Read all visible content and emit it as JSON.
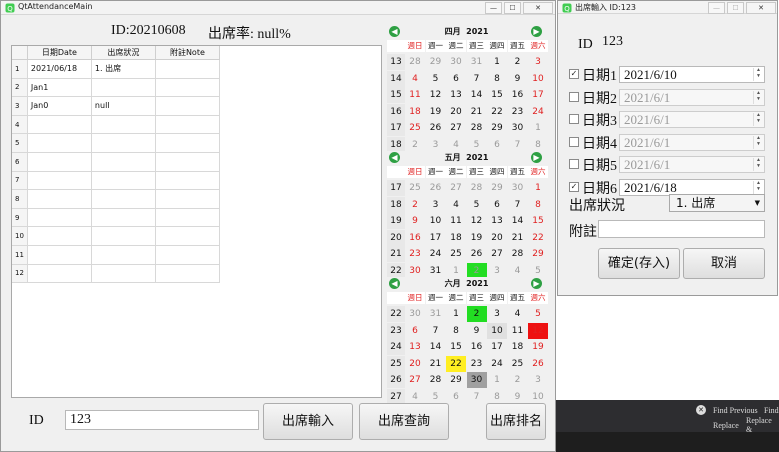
{
  "main": {
    "title": "QtAttendanceMain",
    "header_id": "ID:20210608",
    "header_rate": "出席率: null%",
    "table": {
      "columns": [
        "日期Date",
        "出席狀況",
        "附註Note"
      ],
      "rows": [
        {
          "num": "1",
          "date": "2021/06/18",
          "status": "1. 出席",
          "note": ""
        },
        {
          "num": "2",
          "date": "Jan1",
          "status": "",
          "note": ""
        },
        {
          "num": "3",
          "date": "Jan0",
          "status": "null",
          "note": ""
        },
        {
          "num": "4",
          "date": "",
          "status": "",
          "note": ""
        },
        {
          "num": "5",
          "date": "",
          "status": "",
          "note": ""
        },
        {
          "num": "6",
          "date": "",
          "status": "",
          "note": ""
        },
        {
          "num": "7",
          "date": "",
          "status": "",
          "note": ""
        },
        {
          "num": "8",
          "date": "",
          "status": "",
          "note": ""
        },
        {
          "num": "9",
          "date": "",
          "status": "",
          "note": ""
        },
        {
          "num": "10",
          "date": "",
          "status": "",
          "note": ""
        },
        {
          "num": "11",
          "date": "",
          "status": "",
          "note": ""
        },
        {
          "num": "12",
          "date": "",
          "status": "",
          "note": ""
        }
      ]
    },
    "id_label": "ID",
    "id_value": "123",
    "buttons": {
      "input": "出席輸入",
      "query": "出席查詢",
      "rank": "出席排名"
    }
  },
  "calendars": [
    {
      "month": "四月",
      "year": "2021",
      "dow": [
        "週日",
        "週一",
        "週二",
        "週三",
        "週四",
        "週五",
        "週六"
      ],
      "weeks": [
        {
          "wk": "13",
          "days": [
            "28",
            "29",
            "30",
            "31",
            "1",
            "2",
            "3"
          ]
        },
        {
          "wk": "14",
          "days": [
            "4",
            "5",
            "6",
            "7",
            "8",
            "9",
            "10"
          ]
        },
        {
          "wk": "15",
          "days": [
            "11",
            "12",
            "13",
            "14",
            "15",
            "16",
            "17"
          ]
        },
        {
          "wk": "16",
          "days": [
            "18",
            "19",
            "20",
            "21",
            "22",
            "23",
            "24"
          ]
        },
        {
          "wk": "17",
          "days": [
            "25",
            "26",
            "27",
            "28",
            "29",
            "30",
            "1"
          ]
        },
        {
          "wk": "18",
          "days": [
            "2",
            "3",
            "4",
            "5",
            "6",
            "7",
            "8"
          ]
        }
      ],
      "grey": [
        [
          0,
          0
        ],
        [
          0,
          1
        ],
        [
          0,
          2
        ],
        [
          0,
          3
        ],
        [
          4,
          6
        ],
        [
          5,
          0
        ],
        [
          5,
          1
        ],
        [
          5,
          2
        ],
        [
          5,
          3
        ],
        [
          5,
          4
        ],
        [
          5,
          5
        ],
        [
          5,
          6
        ]
      ],
      "highlights": []
    },
    {
      "month": "五月",
      "year": "2021",
      "dow": [
        "週日",
        "週一",
        "週二",
        "週三",
        "週四",
        "週五",
        "週六"
      ],
      "weeks": [
        {
          "wk": "17",
          "days": [
            "25",
            "26",
            "27",
            "28",
            "29",
            "30",
            "1"
          ]
        },
        {
          "wk": "18",
          "days": [
            "2",
            "3",
            "4",
            "5",
            "6",
            "7",
            "8"
          ]
        },
        {
          "wk": "19",
          "days": [
            "9",
            "10",
            "11",
            "12",
            "13",
            "14",
            "15"
          ]
        },
        {
          "wk": "20",
          "days": [
            "16",
            "17",
            "18",
            "19",
            "20",
            "21",
            "22"
          ]
        },
        {
          "wk": "21",
          "days": [
            "23",
            "24",
            "25",
            "26",
            "27",
            "28",
            "29"
          ]
        },
        {
          "wk": "22",
          "days": [
            "30",
            "31",
            "1",
            "2",
            "3",
            "4",
            "5"
          ]
        }
      ],
      "grey": [
        [
          0,
          0
        ],
        [
          0,
          1
        ],
        [
          0,
          2
        ],
        [
          0,
          3
        ],
        [
          0,
          4
        ],
        [
          0,
          5
        ],
        [
          5,
          2
        ],
        [
          5,
          3
        ],
        [
          5,
          4
        ],
        [
          5,
          5
        ],
        [
          5,
          6
        ]
      ],
      "highlights": [
        {
          "r": 5,
          "c": 3,
          "color": "#22dd22"
        }
      ]
    },
    {
      "month": "六月",
      "year": "2021",
      "dow": [
        "週日",
        "週一",
        "週二",
        "週三",
        "週四",
        "週五",
        "週六"
      ],
      "weeks": [
        {
          "wk": "22",
          "days": [
            "30",
            "31",
            "1",
            "2",
            "3",
            "4",
            "5"
          ]
        },
        {
          "wk": "23",
          "days": [
            "6",
            "7",
            "8",
            "9",
            "10",
            "11",
            "12"
          ]
        },
        {
          "wk": "24",
          "days": [
            "13",
            "14",
            "15",
            "16",
            "17",
            "18",
            "19"
          ]
        },
        {
          "wk": "25",
          "days": [
            "20",
            "21",
            "22",
            "23",
            "24",
            "25",
            "26"
          ]
        },
        {
          "wk": "26",
          "days": [
            "27",
            "28",
            "29",
            "30",
            "1",
            "2",
            "3"
          ]
        },
        {
          "wk": "27",
          "days": [
            "4",
            "5",
            "6",
            "7",
            "8",
            "9",
            "10"
          ]
        }
      ],
      "grey": [
        [
          0,
          0
        ],
        [
          0,
          1
        ],
        [
          4,
          4
        ],
        [
          4,
          5
        ],
        [
          4,
          6
        ],
        [
          5,
          0
        ],
        [
          5,
          1
        ],
        [
          5,
          2
        ],
        [
          5,
          3
        ],
        [
          5,
          4
        ],
        [
          5,
          5
        ],
        [
          5,
          6
        ]
      ],
      "highlights": [
        {
          "r": 0,
          "c": 3,
          "color": "#22dd22"
        },
        {
          "r": 1,
          "c": 6,
          "color": "#ee1111"
        },
        {
          "r": 3,
          "c": 2,
          "color": "#ffee22"
        },
        {
          "r": 4,
          "c": 3,
          "color": "#a0a0a0"
        },
        {
          "r": 1,
          "c": 4,
          "color": "#e0e0e0"
        }
      ]
    }
  ],
  "dialog": {
    "title": "出席輸入 ID:123",
    "id_label": "ID",
    "id_value": "123",
    "dates": [
      {
        "label": "日期1",
        "value": "2021/6/10",
        "checked": true
      },
      {
        "label": "日期2",
        "value": "2021/6/1",
        "checked": false
      },
      {
        "label": "日期3",
        "value": "2021/6/1",
        "checked": false
      },
      {
        "label": "日期4",
        "value": "2021/6/1",
        "checked": false
      },
      {
        "label": "日期5",
        "value": "2021/6/1",
        "checked": false
      },
      {
        "label": "日期6",
        "value": "2021/6/18",
        "checked": true
      }
    ],
    "status_label": "出席狀況",
    "status_value": "1. 出席",
    "note_label": "附註",
    "note_value": "",
    "confirm": "確定(存入)",
    "cancel": "取消"
  },
  "background": {
    "find_previous": "Find Previous",
    "find": "Find",
    "replace": "Replace",
    "replace_all": "Replace &"
  }
}
